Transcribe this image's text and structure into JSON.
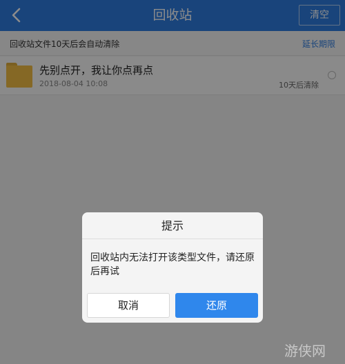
{
  "header": {
    "title": "回收站",
    "clear_label": "清空",
    "back_icon": "chevron-left-icon"
  },
  "notice": {
    "text": "回收站文件10天后会自动清除",
    "extend_label": "延长期限"
  },
  "files": [
    {
      "icon": "folder-icon",
      "name": "先别点开，我让你点再点",
      "date": "2018-08-04  10:08",
      "expire": "10天后清除"
    }
  ],
  "dialog": {
    "title": "提示",
    "message": "回收站内无法打开该类型文件，请还原后再试",
    "cancel_label": "取消",
    "confirm_label": "还原"
  },
  "watermark": {
    "text": "游侠网"
  },
  "colors": {
    "accent": "#2f7de0",
    "confirm_button": "#2f87ec",
    "folder": "#f2be44"
  }
}
